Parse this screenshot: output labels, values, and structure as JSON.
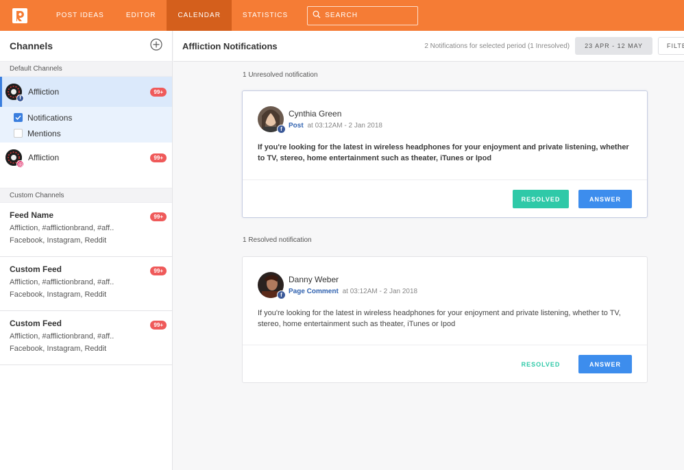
{
  "nav": {
    "items": [
      {
        "label": "POST IDEAS",
        "active": false
      },
      {
        "label": "EDITOR",
        "active": false
      },
      {
        "label": "CALENDAR",
        "active": true
      },
      {
        "label": "STATISTICS",
        "active": false
      }
    ],
    "search_placeholder": "SEARCH"
  },
  "sidebar": {
    "title": "Channels",
    "default_label": "Default Channels",
    "channels": [
      {
        "name": "Affliction",
        "badge": "99+",
        "network": "facebook"
      },
      {
        "name": "Affliction",
        "badge": "99+",
        "network": "instagram"
      }
    ],
    "sub_items": [
      {
        "label": "Notifications",
        "checked": true
      },
      {
        "label": "Mentions",
        "checked": false
      }
    ],
    "custom_label": "Custom Channels",
    "feeds": [
      {
        "name": "Feed Name",
        "tags": "Affliction, #afflictionbrand, #aff..",
        "networks": "Facebook, Instagram, Reddit",
        "badge": "99+"
      },
      {
        "name": "Custom Feed",
        "tags": "Affliction, #afflictionbrand, #aff..",
        "networks": "Facebook, Instagram, Reddit",
        "badge": "99+"
      },
      {
        "name": "Custom Feed",
        "tags": "Affliction, #afflictionbrand, #aff..",
        "networks": "Facebook, Instagram, Reddit",
        "badge": "99+"
      }
    ]
  },
  "main": {
    "title": "Affliction Notifications",
    "period_info": "2 Notifications for selected period (1 Inresolved)",
    "date_range": "23 APR - 12 MAY",
    "filter_label": "FILTER",
    "unresolved_label": "1 Unresolved notification",
    "resolved_label": "1 Resolved notification",
    "notifications": [
      {
        "author": "Cynthia Green",
        "type": "Post",
        "time": "at 03:12AM - 2 Jan 2018",
        "text": "If you're looking for the latest in wireless headphones for your enjoyment and private listening, whether to TV, stereo, home entertainment such as theater, iTunes or Ipod",
        "resolved_label": "RESOLVED",
        "answer_label": "ANSWER"
      },
      {
        "author": "Danny Weber",
        "type": "Page Comment",
        "time": "at 03:12AM - 2 Jan 2018",
        "text": "If you're looking for the latest in wireless headphones for your enjoyment and private listening, whether to TV, stereo, home entertainment such as theater, iTunes or Ipod",
        "resolved_label": "RESOLVED",
        "answer_label": "ANSWER"
      }
    ]
  },
  "colors": {
    "brand": "#f57c35",
    "brand_active": "#d45f1c",
    "selected_bg": "#dbe9fb",
    "badge": "#ef5a5a",
    "resolved": "#2fc9a8",
    "answer": "#3d8ded"
  },
  "icons": [
    "app-logo-icon",
    "search-icon",
    "add-channel-icon",
    "facebook-icon",
    "instagram-icon",
    "checkbox-icon"
  ]
}
